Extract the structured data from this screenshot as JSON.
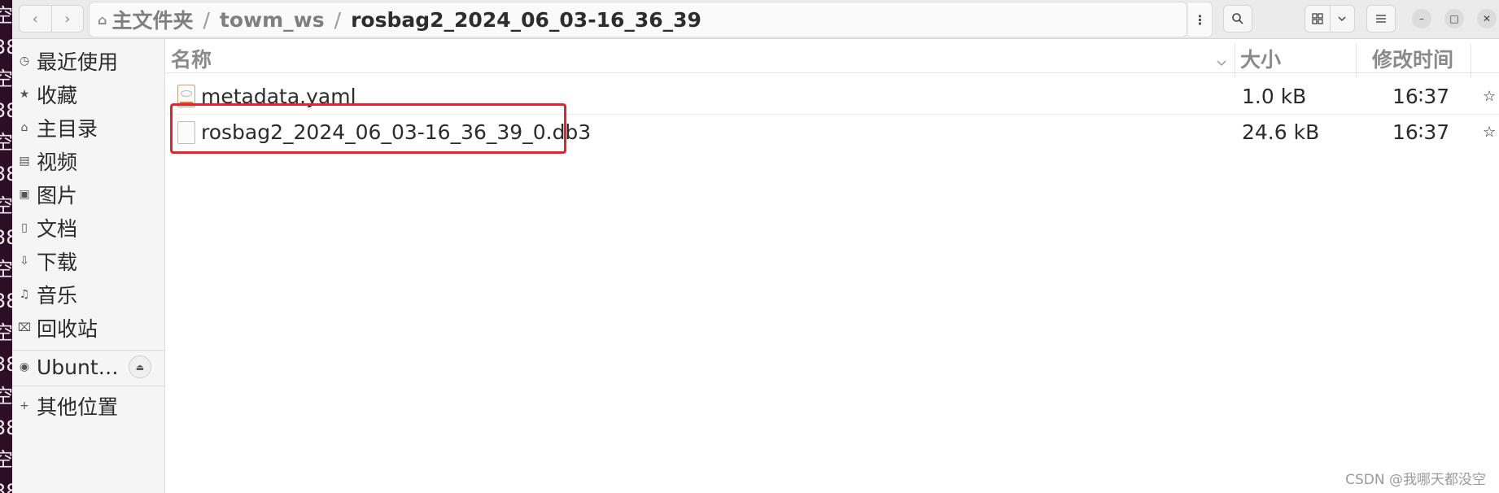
{
  "desktop": {
    "glyphs": [
      "空",
      "38",
      "空",
      "38",
      "空",
      "38",
      "空",
      "38",
      "空",
      "38",
      "空",
      "38",
      "空",
      "38",
      "空",
      "38"
    ]
  },
  "toolbar": {
    "back_icon": "chevron-left-icon",
    "forward_icon": "chevron-right-icon",
    "path": {
      "home_icon": "home-icon",
      "segments": [
        "主文件夹",
        "towm_ws"
      ],
      "current": "rosbag2_2024_06_03-16_36_39",
      "separator": "/"
    },
    "path_menu_icon": "vertical-ellipsis-icon",
    "search_icon": "search-icon",
    "view_icon": "grid-view-icon",
    "view_dropdown_icon": "chevron-down-icon",
    "menu_icon": "hamburger-menu-icon",
    "window_controls": {
      "minimize": "–",
      "maximize": "□",
      "close": "✕"
    }
  },
  "sidebar": {
    "items": [
      {
        "label": "最近使用",
        "icon": "recent-icon",
        "glyph": "◷"
      },
      {
        "label": "收藏",
        "icon": "star-icon",
        "glyph": "★"
      },
      {
        "label": "主目录",
        "icon": "home-icon",
        "glyph": "⌂"
      },
      {
        "label": "视频",
        "icon": "video-icon",
        "glyph": "▤"
      },
      {
        "label": "图片",
        "icon": "image-icon",
        "glyph": "▣"
      },
      {
        "label": "文档",
        "icon": "document-icon",
        "glyph": "▯"
      },
      {
        "label": "下载",
        "icon": "download-icon",
        "glyph": "⇩"
      },
      {
        "label": "音乐",
        "icon": "music-icon",
        "glyph": "♫"
      },
      {
        "label": "回收站",
        "icon": "trash-icon",
        "glyph": "⌧"
      }
    ],
    "device": {
      "label": "Ubunt…",
      "icon": "disc-icon",
      "glyph": "◉",
      "eject_glyph": "⏏"
    },
    "other": {
      "label": "其他位置",
      "icon": "plus-icon",
      "glyph": "+"
    }
  },
  "columns": {
    "name": "名称",
    "size": "大小",
    "modified": "修改时间",
    "sort_icon": "chevron-down-icon"
  },
  "files": [
    {
      "name": "metadata.yaml",
      "size": "1.0 kB",
      "modified": "16∶37",
      "icon": "yaml-file-icon",
      "star": "☆"
    },
    {
      "name": "rosbag2_2024_06_03-16_36_39_0.db3",
      "size": "24.6 kB",
      "modified": "16∶37",
      "icon": "generic-file-icon",
      "star": "☆"
    }
  ],
  "watermark": "CSDN @我哪天都没空",
  "colors": {
    "accent_highlight": "#e8222b",
    "header_bg": "#ebebeb",
    "sidebar_bg": "#f5f5f5"
  }
}
